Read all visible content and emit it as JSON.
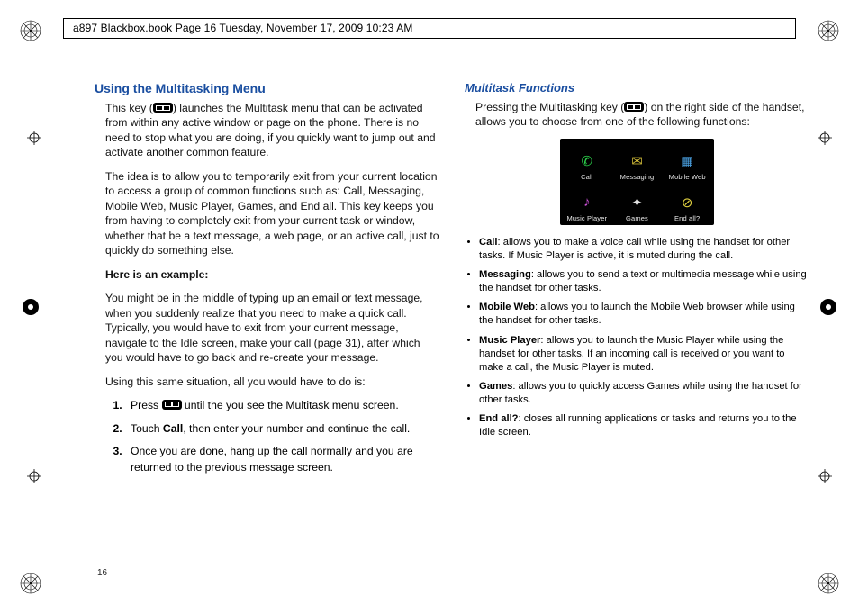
{
  "frame_header": "a897 Blackbox.book  Page 16  Tuesday, November 17, 2009  10:23 AM",
  "page_number": "16",
  "left": {
    "heading": "Using the Multitasking Menu",
    "p1a": "This key (",
    "p1b": ") launches the Multitask menu that can be activated from within any active window or page on the phone. There is no need to stop what you are doing, if you quickly want to jump out and activate another common feature.",
    "p2": "The idea is to allow you to temporarily exit from your current location to access a group of common functions such as: Call, Messaging, Mobile Web, Music Player, Games, and End all. This key keeps you from having to completely exit from your current task or window, whether that be a text message, a web page, or an active call, just to quickly do something else.",
    "example_label": "Here is an example:",
    "p3": "You might be in the middle of typing up an email or text message, when you suddenly realize that you need to make a quick call. Typically, you would have to exit from your current message, navigate to the Idle screen, make your call (page 31), after which you would have to go back and re-create your message.",
    "p4": "Using this same situation, all you would have to do is:",
    "step1a": "Press ",
    "step1b": " until the you see the Multitask menu screen.",
    "step2a": "Touch ",
    "step2b": "Call",
    "step2c": ", then enter your number and continue the call.",
    "step3": "Once you are done, hang up the call normally and you are returned to the previous message screen."
  },
  "right": {
    "heading": "Multitask Functions",
    "p1a": "Pressing the Multitasking key (",
    "p1b": ") on the right side of the handset, allows you to choose from one of the following functions:",
    "menu": [
      {
        "label": "Call",
        "glyph": "✆",
        "color": "#2bd04a"
      },
      {
        "label": "Messaging",
        "glyph": "✉",
        "color": "#d8c23a"
      },
      {
        "label": "Mobile Web",
        "glyph": "▦",
        "color": "#4aa0e0"
      },
      {
        "label": "Music Player",
        "glyph": "♪",
        "color": "#c54dd0"
      },
      {
        "label": "Games",
        "glyph": "✦",
        "color": "#e0e0e0"
      },
      {
        "label": "End all?",
        "glyph": "⊘",
        "color": "#e0d040"
      }
    ],
    "funcs": [
      {
        "name": "Call",
        "desc": ": allows you to make a voice call while using the handset for other tasks. If Music Player is active, it is muted during the call."
      },
      {
        "name": "Messaging",
        "desc": ": allows you to send a text or multimedia message while using the handset for other tasks."
      },
      {
        "name": "Mobile Web",
        "desc": ": allows you to launch the Mobile Web browser while using the handset for other tasks."
      },
      {
        "name": "Music Player",
        "desc": ": allows you to launch the Music Player while using the handset for other tasks. If an incoming call is received or you want to make a call, the Music Player is muted."
      },
      {
        "name": "Games",
        "desc": ": allows you to quickly access Games while using the handset for other tasks."
      },
      {
        "name": "End all?",
        "desc": ": closes all running applications or tasks and returns you to the Idle screen."
      }
    ]
  }
}
